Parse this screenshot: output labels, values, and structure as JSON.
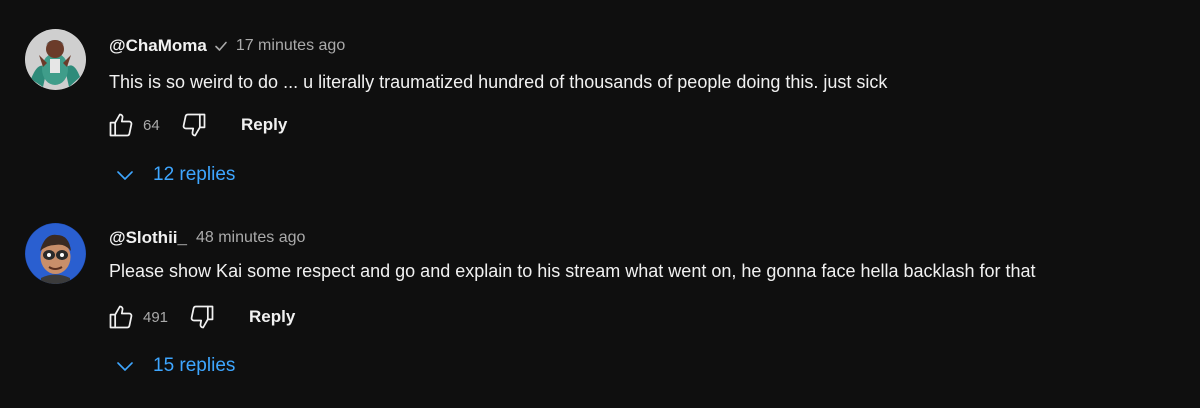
{
  "comments": [
    {
      "author": "@ChaMoma",
      "verified": true,
      "time": "17 minutes ago",
      "text": "This is so weird to do ... u literally traumatized hundred of thousands of people doing this. just sick",
      "likes": "64",
      "reply_label": "Reply",
      "replies_label": "12 replies",
      "avatar_colors": {
        "bg": "#d9d9d9",
        "accent": "#2e8b7a",
        "figure": "#6b3b2a"
      }
    },
    {
      "author": "@Slothii_",
      "verified": false,
      "time": "48 minutes ago",
      "text": "Please show Kai some respect and go and explain to his stream what went on, he gonna face hella backlash for that",
      "likes": "491",
      "reply_label": "Reply",
      "replies_label": "15 replies",
      "avatar_colors": {
        "bg": "#1e4fb8",
        "accent": "#2a2a2a",
        "figure": "#c98f6a"
      }
    }
  ],
  "icons": {
    "like": "thumbs-up-icon",
    "dislike": "thumbs-down-icon",
    "verified": "checkmark-icon",
    "expand": "chevron-down-icon"
  },
  "colors": {
    "background": "#0f0f0f",
    "text": "#f1f1f1",
    "secondary": "#aaaaaa",
    "link": "#3ea6ff"
  }
}
